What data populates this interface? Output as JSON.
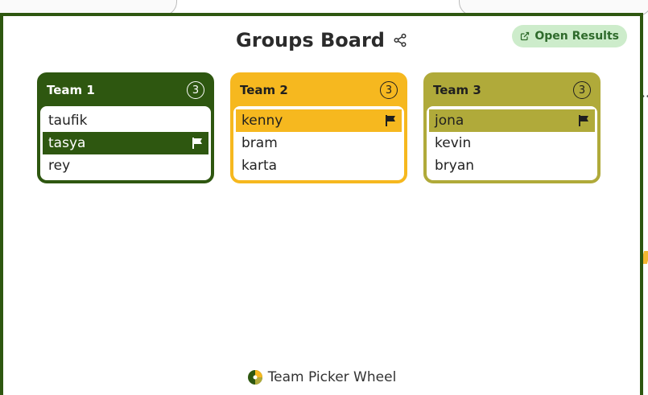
{
  "header": {
    "title": "Groups Board",
    "open_results_label": "Open Results"
  },
  "teams": [
    {
      "name": "Team 1",
      "count": "3",
      "color": "#2e5710",
      "header_text_color": "#ffffff",
      "members": [
        {
          "name": "taufik",
          "leader": false
        },
        {
          "name": "tasya",
          "leader": true
        },
        {
          "name": "rey",
          "leader": false
        }
      ]
    },
    {
      "name": "Team 2",
      "count": "3",
      "color": "#f6b81f",
      "header_text_color": "#1f1f1f",
      "members": [
        {
          "name": "kenny",
          "leader": true
        },
        {
          "name": "bram",
          "leader": false
        },
        {
          "name": "karta",
          "leader": false
        }
      ]
    },
    {
      "name": "Team 3",
      "count": "3",
      "color": "#b0aa3a",
      "header_text_color": "#1f1f1f",
      "members": [
        {
          "name": "jona",
          "leader": true
        },
        {
          "name": "kevin",
          "leader": false
        },
        {
          "name": "bryan",
          "leader": false
        }
      ]
    }
  ],
  "footer": {
    "brand": "Team Picker Wheel"
  },
  "icons": {
    "share": "share-icon",
    "external": "external-link-icon",
    "flag": "flag-icon",
    "logo": "wheel-logo-icon"
  }
}
